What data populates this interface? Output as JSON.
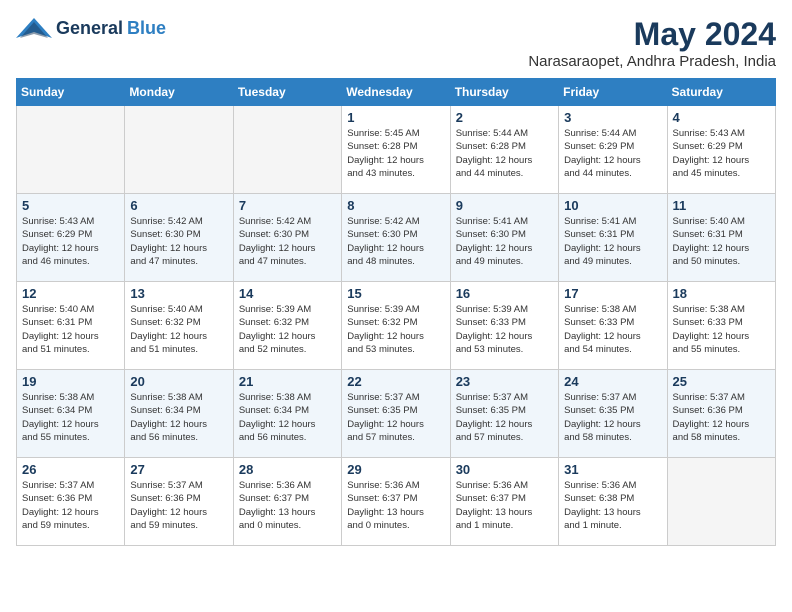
{
  "header": {
    "logo_general": "General",
    "logo_blue": "Blue",
    "month_title": "May 2024",
    "location": "Narasaraopet, Andhra Pradesh, India"
  },
  "days_of_week": [
    "Sunday",
    "Monday",
    "Tuesday",
    "Wednesday",
    "Thursday",
    "Friday",
    "Saturday"
  ],
  "weeks": [
    [
      {
        "day": "",
        "detail": ""
      },
      {
        "day": "",
        "detail": ""
      },
      {
        "day": "",
        "detail": ""
      },
      {
        "day": "1",
        "detail": "Sunrise: 5:45 AM\nSunset: 6:28 PM\nDaylight: 12 hours\nand 43 minutes."
      },
      {
        "day": "2",
        "detail": "Sunrise: 5:44 AM\nSunset: 6:28 PM\nDaylight: 12 hours\nand 44 minutes."
      },
      {
        "day": "3",
        "detail": "Sunrise: 5:44 AM\nSunset: 6:29 PM\nDaylight: 12 hours\nand 44 minutes."
      },
      {
        "day": "4",
        "detail": "Sunrise: 5:43 AM\nSunset: 6:29 PM\nDaylight: 12 hours\nand 45 minutes."
      }
    ],
    [
      {
        "day": "5",
        "detail": "Sunrise: 5:43 AM\nSunset: 6:29 PM\nDaylight: 12 hours\nand 46 minutes."
      },
      {
        "day": "6",
        "detail": "Sunrise: 5:42 AM\nSunset: 6:30 PM\nDaylight: 12 hours\nand 47 minutes."
      },
      {
        "day": "7",
        "detail": "Sunrise: 5:42 AM\nSunset: 6:30 PM\nDaylight: 12 hours\nand 47 minutes."
      },
      {
        "day": "8",
        "detail": "Sunrise: 5:42 AM\nSunset: 6:30 PM\nDaylight: 12 hours\nand 48 minutes."
      },
      {
        "day": "9",
        "detail": "Sunrise: 5:41 AM\nSunset: 6:30 PM\nDaylight: 12 hours\nand 49 minutes."
      },
      {
        "day": "10",
        "detail": "Sunrise: 5:41 AM\nSunset: 6:31 PM\nDaylight: 12 hours\nand 49 minutes."
      },
      {
        "day": "11",
        "detail": "Sunrise: 5:40 AM\nSunset: 6:31 PM\nDaylight: 12 hours\nand 50 minutes."
      }
    ],
    [
      {
        "day": "12",
        "detail": "Sunrise: 5:40 AM\nSunset: 6:31 PM\nDaylight: 12 hours\nand 51 minutes."
      },
      {
        "day": "13",
        "detail": "Sunrise: 5:40 AM\nSunset: 6:32 PM\nDaylight: 12 hours\nand 51 minutes."
      },
      {
        "day": "14",
        "detail": "Sunrise: 5:39 AM\nSunset: 6:32 PM\nDaylight: 12 hours\nand 52 minutes."
      },
      {
        "day": "15",
        "detail": "Sunrise: 5:39 AM\nSunset: 6:32 PM\nDaylight: 12 hours\nand 53 minutes."
      },
      {
        "day": "16",
        "detail": "Sunrise: 5:39 AM\nSunset: 6:33 PM\nDaylight: 12 hours\nand 53 minutes."
      },
      {
        "day": "17",
        "detail": "Sunrise: 5:38 AM\nSunset: 6:33 PM\nDaylight: 12 hours\nand 54 minutes."
      },
      {
        "day": "18",
        "detail": "Sunrise: 5:38 AM\nSunset: 6:33 PM\nDaylight: 12 hours\nand 55 minutes."
      }
    ],
    [
      {
        "day": "19",
        "detail": "Sunrise: 5:38 AM\nSunset: 6:34 PM\nDaylight: 12 hours\nand 55 minutes."
      },
      {
        "day": "20",
        "detail": "Sunrise: 5:38 AM\nSunset: 6:34 PM\nDaylight: 12 hours\nand 56 minutes."
      },
      {
        "day": "21",
        "detail": "Sunrise: 5:38 AM\nSunset: 6:34 PM\nDaylight: 12 hours\nand 56 minutes."
      },
      {
        "day": "22",
        "detail": "Sunrise: 5:37 AM\nSunset: 6:35 PM\nDaylight: 12 hours\nand 57 minutes."
      },
      {
        "day": "23",
        "detail": "Sunrise: 5:37 AM\nSunset: 6:35 PM\nDaylight: 12 hours\nand 57 minutes."
      },
      {
        "day": "24",
        "detail": "Sunrise: 5:37 AM\nSunset: 6:35 PM\nDaylight: 12 hours\nand 58 minutes."
      },
      {
        "day": "25",
        "detail": "Sunrise: 5:37 AM\nSunset: 6:36 PM\nDaylight: 12 hours\nand 58 minutes."
      }
    ],
    [
      {
        "day": "26",
        "detail": "Sunrise: 5:37 AM\nSunset: 6:36 PM\nDaylight: 12 hours\nand 59 minutes."
      },
      {
        "day": "27",
        "detail": "Sunrise: 5:37 AM\nSunset: 6:36 PM\nDaylight: 12 hours\nand 59 minutes."
      },
      {
        "day": "28",
        "detail": "Sunrise: 5:36 AM\nSunset: 6:37 PM\nDaylight: 13 hours\nand 0 minutes."
      },
      {
        "day": "29",
        "detail": "Sunrise: 5:36 AM\nSunset: 6:37 PM\nDaylight: 13 hours\nand 0 minutes."
      },
      {
        "day": "30",
        "detail": "Sunrise: 5:36 AM\nSunset: 6:37 PM\nDaylight: 13 hours\nand 1 minute."
      },
      {
        "day": "31",
        "detail": "Sunrise: 5:36 AM\nSunset: 6:38 PM\nDaylight: 13 hours\nand 1 minute."
      },
      {
        "day": "",
        "detail": ""
      }
    ]
  ]
}
